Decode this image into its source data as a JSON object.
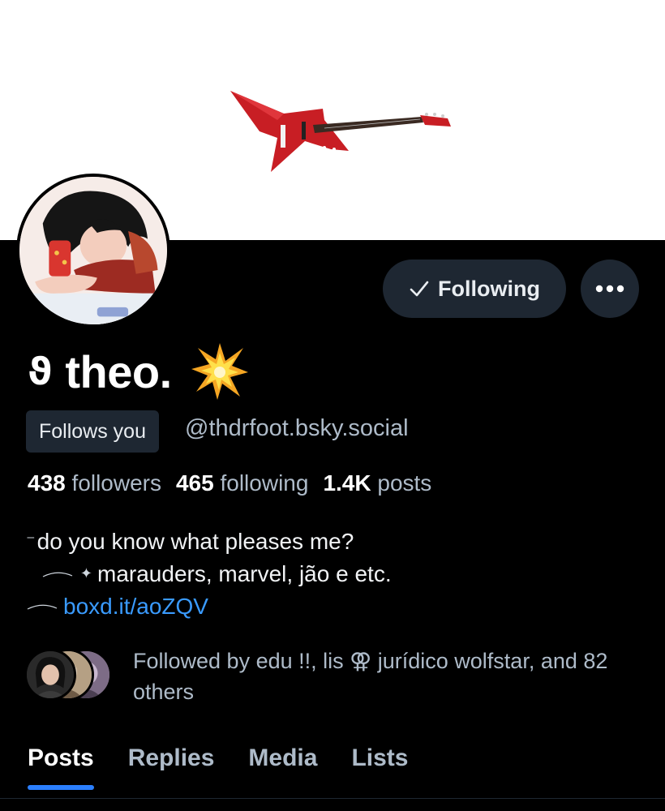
{
  "banner": {
    "image": "red-star-guitar"
  },
  "avatar": {
    "image": "illustrated-person-with-phone"
  },
  "actions": {
    "following_label": "Following",
    "following_icon": "checkmark-icon",
    "more_icon": "ellipsis-icon"
  },
  "profile": {
    "name_glyph": "ϑ",
    "display_name": "theo.",
    "name_emoji": "collision-emoji",
    "follows_you": "Follows you",
    "handle": "@thdrfoot.bsky.social"
  },
  "stats": {
    "followers_count": "438",
    "followers_label": "followers",
    "following_count": "465",
    "following_label": "following",
    "posts_count": "1.4K",
    "posts_label": "posts"
  },
  "bio": {
    "line1": "do you know what pleases me?",
    "line2": "marauders, marvel, jão e etc.",
    "link": "boxd.it/aoZQV"
  },
  "followed_by": {
    "text": "Followed by edu !!, lis ⚢ jurídico wolfstar, and 82 others"
  },
  "tabs": [
    {
      "label": "Posts",
      "active": true
    },
    {
      "label": "Replies",
      "active": false
    },
    {
      "label": "Media",
      "active": false
    },
    {
      "label": "Lists",
      "active": false
    }
  ],
  "colors": {
    "background": "#000000",
    "button_bg": "#1e2732",
    "muted_text": "#aebbc9",
    "link": "#3a9bff",
    "tab_indicator": "#2b7fff"
  }
}
